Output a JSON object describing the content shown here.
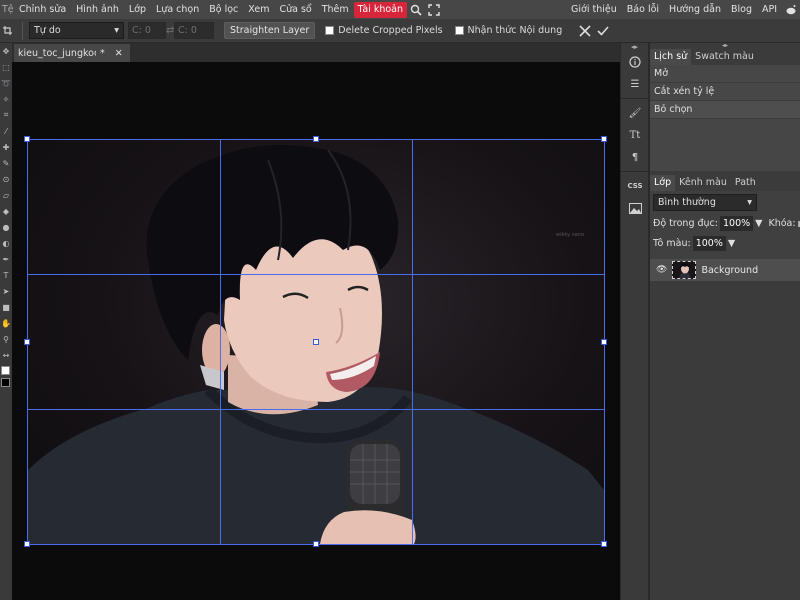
{
  "menu": {
    "items": [
      "Tệp",
      "Chỉnh sửa",
      "Hình ảnh",
      "Lớp",
      "Lựa chọn",
      "Bộ lọc",
      "Xem",
      "Cửa sổ",
      "Thêm",
      "Tài khoản"
    ],
    "right": [
      "Giới thiệu",
      "Báo lỗi",
      "Hướng dẫn",
      "Blog",
      "API"
    ]
  },
  "options": {
    "ratio_value": "Tự do",
    "w_placeholder": "C: 0",
    "h_placeholder": "C: 0",
    "straighten_label": "Straighten Layer",
    "delete_cropped_label": "Delete Cropped Pixels",
    "content_aware_label": "Nhận thức Nội dung"
  },
  "document": {
    "tab_name": "kieu_toc_jungkook",
    "modified_mark": "*",
    "watermark": "wikky nano"
  },
  "history_panel": {
    "tabs": [
      "Lịch sử",
      "Swatch màu"
    ],
    "items": [
      "Mở",
      "Cắt xén tỷ lệ",
      "Bỏ chọn"
    ]
  },
  "layers_panel": {
    "tabs": [
      "Lớp",
      "Kênh màu",
      "Path"
    ],
    "blend_mode": "Bình thường",
    "opacity_label": "Độ trong đục:",
    "opacity_value": "100%",
    "lock_label": "Khóa:",
    "fill_label": "Tô màu:",
    "fill_value": "100%",
    "layers": [
      {
        "name": "Background"
      }
    ]
  },
  "colors": {
    "accent_account": "#d7263b",
    "crop_grid": "#4a6cf0",
    "canvas_bg": "#0b0b0c"
  }
}
